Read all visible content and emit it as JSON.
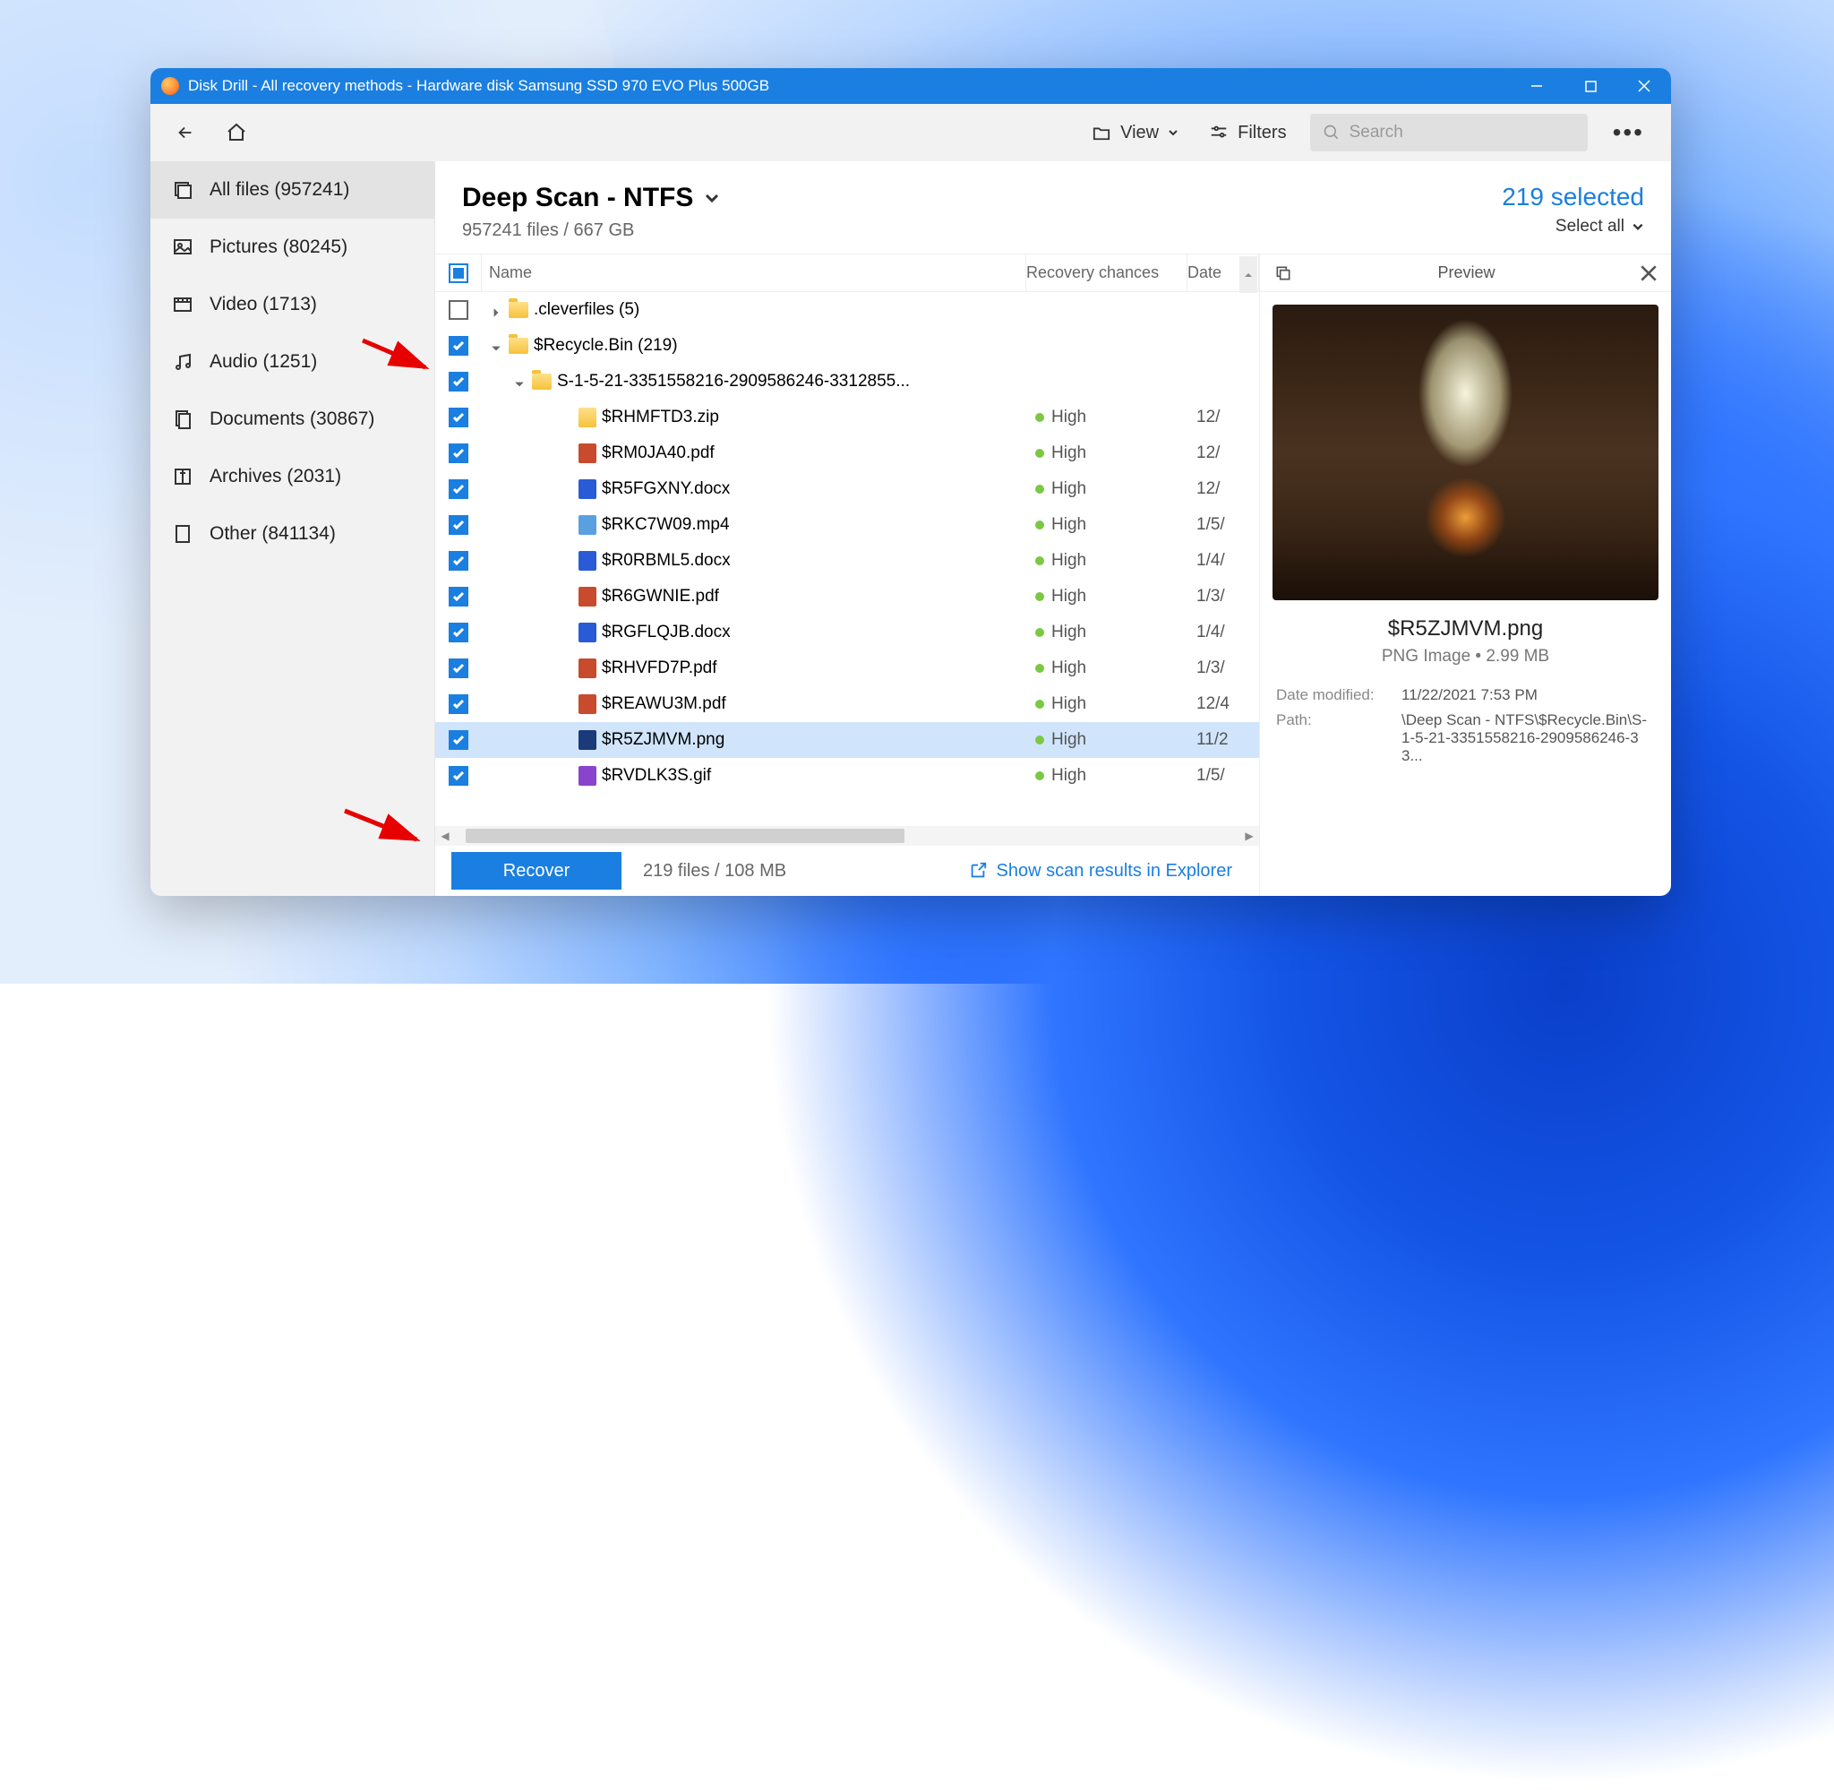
{
  "window": {
    "title": "Disk Drill - All recovery methods - Hardware disk Samsung SSD 970 EVO Plus 500GB"
  },
  "toolbar": {
    "view": "View",
    "filters": "Filters",
    "search_placeholder": "Search"
  },
  "sidebar": {
    "items": [
      {
        "label": "All files (957241)"
      },
      {
        "label": "Pictures (80245)"
      },
      {
        "label": "Video (1713)"
      },
      {
        "label": "Audio (1251)"
      },
      {
        "label": "Documents (30867)"
      },
      {
        "label": "Archives (2031)"
      },
      {
        "label": "Other (841134)"
      }
    ]
  },
  "main": {
    "scan_title": "Deep Scan - NTFS",
    "scan_sub": "957241 files / 667 GB",
    "selected": "219 selected",
    "select_all": "Select all"
  },
  "columns": {
    "name": "Name",
    "recovery": "Recovery chances",
    "date": "Date"
  },
  "rows": [
    {
      "check": "unchecked",
      "indent": 0,
      "caret": "right",
      "type": "folder",
      "name": ".cleverfiles (5)",
      "rec": "",
      "date": ""
    },
    {
      "check": "checked",
      "indent": 0,
      "caret": "down",
      "type": "folder",
      "name": "$Recycle.Bin (219)",
      "rec": "",
      "date": ""
    },
    {
      "check": "checked",
      "indent": 1,
      "caret": "down",
      "type": "folder",
      "name": "S-1-5-21-3351558216-2909586246-3312855...",
      "rec": "",
      "date": ""
    },
    {
      "check": "checked",
      "indent": 2,
      "caret": "",
      "type": "zip",
      "name": "$RHMFTD3.zip",
      "rec": "High",
      "date": "12/"
    },
    {
      "check": "checked",
      "indent": 2,
      "caret": "",
      "type": "pdf",
      "name": "$RM0JA40.pdf",
      "rec": "High",
      "date": "12/"
    },
    {
      "check": "checked",
      "indent": 2,
      "caret": "",
      "type": "doc",
      "name": "$R5FGXNY.docx",
      "rec": "High",
      "date": "12/"
    },
    {
      "check": "checked",
      "indent": 2,
      "caret": "",
      "type": "mp4",
      "name": "$RKC7W09.mp4",
      "rec": "High",
      "date": "1/5/"
    },
    {
      "check": "checked",
      "indent": 2,
      "caret": "",
      "type": "doc",
      "name": "$R0RBML5.docx",
      "rec": "High",
      "date": "1/4/"
    },
    {
      "check": "checked",
      "indent": 2,
      "caret": "",
      "type": "pdf",
      "name": "$R6GWNIE.pdf",
      "rec": "High",
      "date": "1/3/"
    },
    {
      "check": "checked",
      "indent": 2,
      "caret": "",
      "type": "doc",
      "name": "$RGFLQJB.docx",
      "rec": "High",
      "date": "1/4/"
    },
    {
      "check": "checked",
      "indent": 2,
      "caret": "",
      "type": "pdf",
      "name": "$RHVFD7P.pdf",
      "rec": "High",
      "date": "1/3/"
    },
    {
      "check": "checked",
      "indent": 2,
      "caret": "",
      "type": "pdf",
      "name": "$REAWU3M.pdf",
      "rec": "High",
      "date": "12/4"
    },
    {
      "check": "checked",
      "indent": 2,
      "caret": "",
      "type": "png",
      "name": "$R5ZJMVM.png",
      "rec": "High",
      "date": "11/2",
      "selected": true
    },
    {
      "check": "checked",
      "indent": 2,
      "caret": "",
      "type": "gif",
      "name": "$RVDLK3S.gif",
      "rec": "High",
      "date": "1/5/"
    }
  ],
  "footer": {
    "recover": "Recover",
    "stats": "219 files / 108 MB",
    "explorer": "Show scan results in Explorer"
  },
  "preview": {
    "title": "Preview",
    "filename": "$R5ZJMVM.png",
    "meta": "PNG Image • 2.99 MB",
    "modified_label": "Date modified:",
    "modified_value": "11/22/2021 7:53 PM",
    "path_label": "Path:",
    "path_value": "\\Deep Scan - NTFS\\$Recycle.Bin\\S-1-5-21-3351558216-2909586246-33..."
  }
}
